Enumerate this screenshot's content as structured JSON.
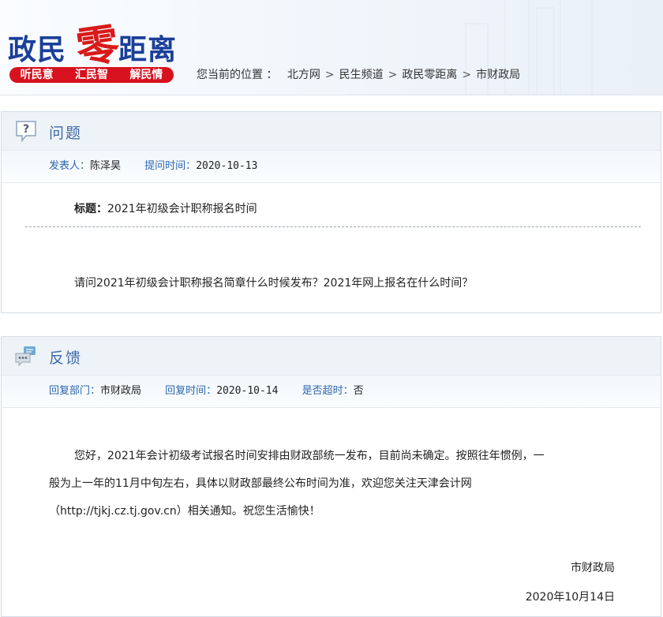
{
  "header": {
    "logo": {
      "part1": "政民",
      "part2": "零",
      "part3": "距离"
    },
    "slogan": [
      "听民意",
      "汇民智",
      "解民情"
    ],
    "breadcrumb_label": "您当前的位置 ：",
    "breadcrumb": [
      "北方网",
      "民生频道",
      "政民零距离",
      "市财政局"
    ]
  },
  "question": {
    "section_title": "问题",
    "poster_label": "发表人：",
    "poster": "陈泽昊",
    "time_label": "提问时间：",
    "time": "2020-10-13",
    "title_label": "标题：",
    "title": "2021年初级会计职称报名时间",
    "body": "请问2021年初级会计职称报名简章什么时候发布？2021年网上报名在什么时间？"
  },
  "feedback": {
    "section_title": "反馈",
    "dept_label": "回复部门：",
    "dept": "市财政局",
    "time_label": "回复时间：",
    "time": "2020-10-14",
    "overtime_label": "是否超时：",
    "overtime": "否",
    "body_line1": "您好，2021年会计初级考试报名时间安排由财政部统一发布，目前尚未确定。按照往年惯例，一",
    "body_line2": "般为上一年的11月中旬左右，具体以财政部最终公布时间为准，欢迎您关注天津会计网",
    "body_line3": "（http://tjkj.cz.tj.gov.cn）相关通知。祝您生活愉快！",
    "signature": "市财政局",
    "date": "2020年10月14日"
  },
  "colors": {
    "brand_red": "#d8111e",
    "brand_blue": "#1b3f99",
    "link_blue": "#2b66b0",
    "panel_bg": "#eef3f8"
  }
}
